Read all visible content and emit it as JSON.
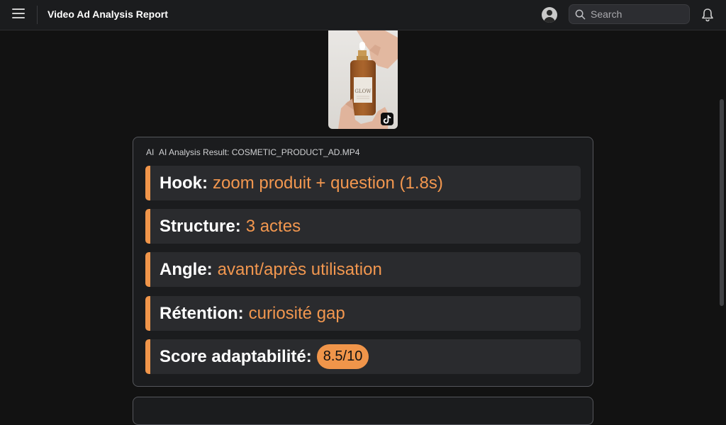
{
  "header": {
    "title": "Video Ad Analysis Report",
    "search_placeholder": "Search"
  },
  "thumbnail": {
    "product_label": "GLOW",
    "platform_icon": "tiktok-icon"
  },
  "analysis": {
    "ai_icon": "AI",
    "title": "AI Analysis Result: COSMETIC_PRODUCT_AD.MP4",
    "rows": [
      {
        "label": "Hook:",
        "value": "zoom produit + question (1.8s)"
      },
      {
        "label": "Structure:",
        "value": "3 actes"
      },
      {
        "label": "Angle:",
        "value": "avant/après utilisation"
      },
      {
        "label": "Rétention:",
        "value": "curiosité gap"
      }
    ],
    "score": {
      "label": "Score adaptabilité:",
      "value": "8.5/10"
    }
  },
  "colors": {
    "accent": "#f0954a",
    "background": "#121212",
    "card": "#1b1c1e"
  }
}
